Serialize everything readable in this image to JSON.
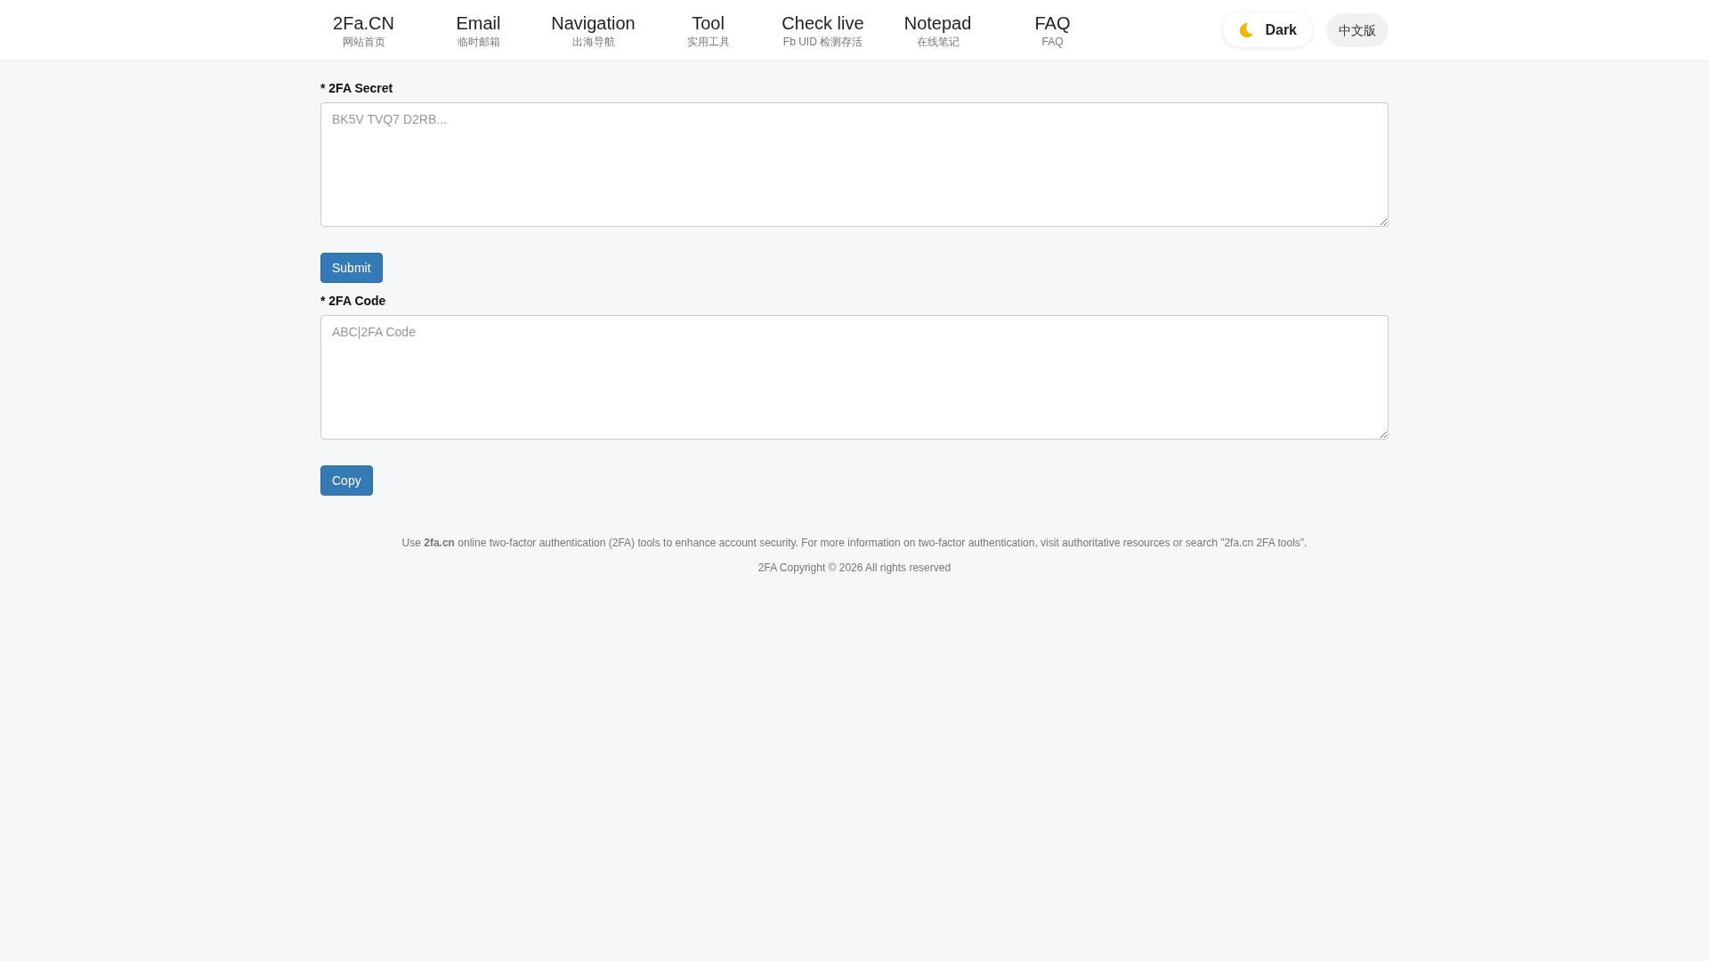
{
  "nav": {
    "items": [
      {
        "title": "2Fa.CN",
        "subtitle": "网站首页"
      },
      {
        "title": "Email",
        "subtitle": "临时邮箱"
      },
      {
        "title": "Navigation",
        "subtitle": "出海导航"
      },
      {
        "title": "Tool",
        "subtitle": "实用工具"
      },
      {
        "title": "Check live",
        "subtitle": "Fb UID 检测存活"
      },
      {
        "title": "Notepad",
        "subtitle": "在线笔记"
      },
      {
        "title": "FAQ",
        "subtitle": "FAQ"
      }
    ]
  },
  "theme_toggle": {
    "label": "Dark"
  },
  "language_button": {
    "label": "中文版"
  },
  "form": {
    "fields": [
      {
        "label": "* 2FA Secret",
        "placeholder": "BK5V TVQ7 D2RB...",
        "button": "Submit"
      },
      {
        "label": "* 2FA Code",
        "placeholder": "ABC|2FA Code",
        "button": "Copy"
      }
    ]
  },
  "footer": {
    "notice": "Use **2fa.cn** online two-factor authentication (2FA) tools to enhance account security. For more information on two-factor authentication, visit authoritative resources or search \"2fa.cn 2FA tools\".",
    "copyright": "2FA Copyright © 2026 All rights reserved"
  }
}
